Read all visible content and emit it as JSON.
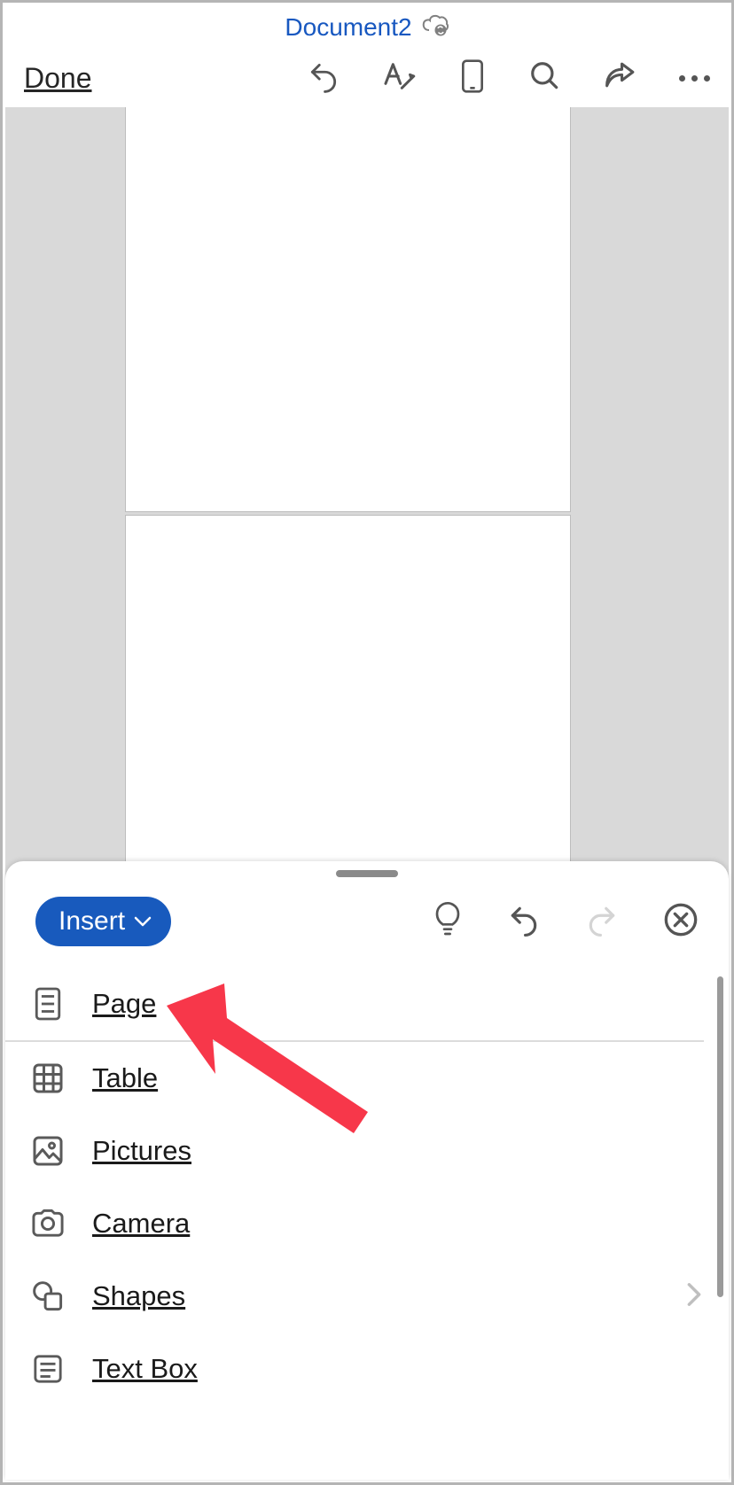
{
  "title": "Document2",
  "toolbar": {
    "done_label": "Done"
  },
  "sheet": {
    "tab_label": "Insert",
    "items": [
      {
        "label": "Page"
      },
      {
        "label": "Table"
      },
      {
        "label": "Pictures"
      },
      {
        "label": "Camera"
      },
      {
        "label": "Shapes"
      },
      {
        "label": "Text Box"
      }
    ]
  }
}
